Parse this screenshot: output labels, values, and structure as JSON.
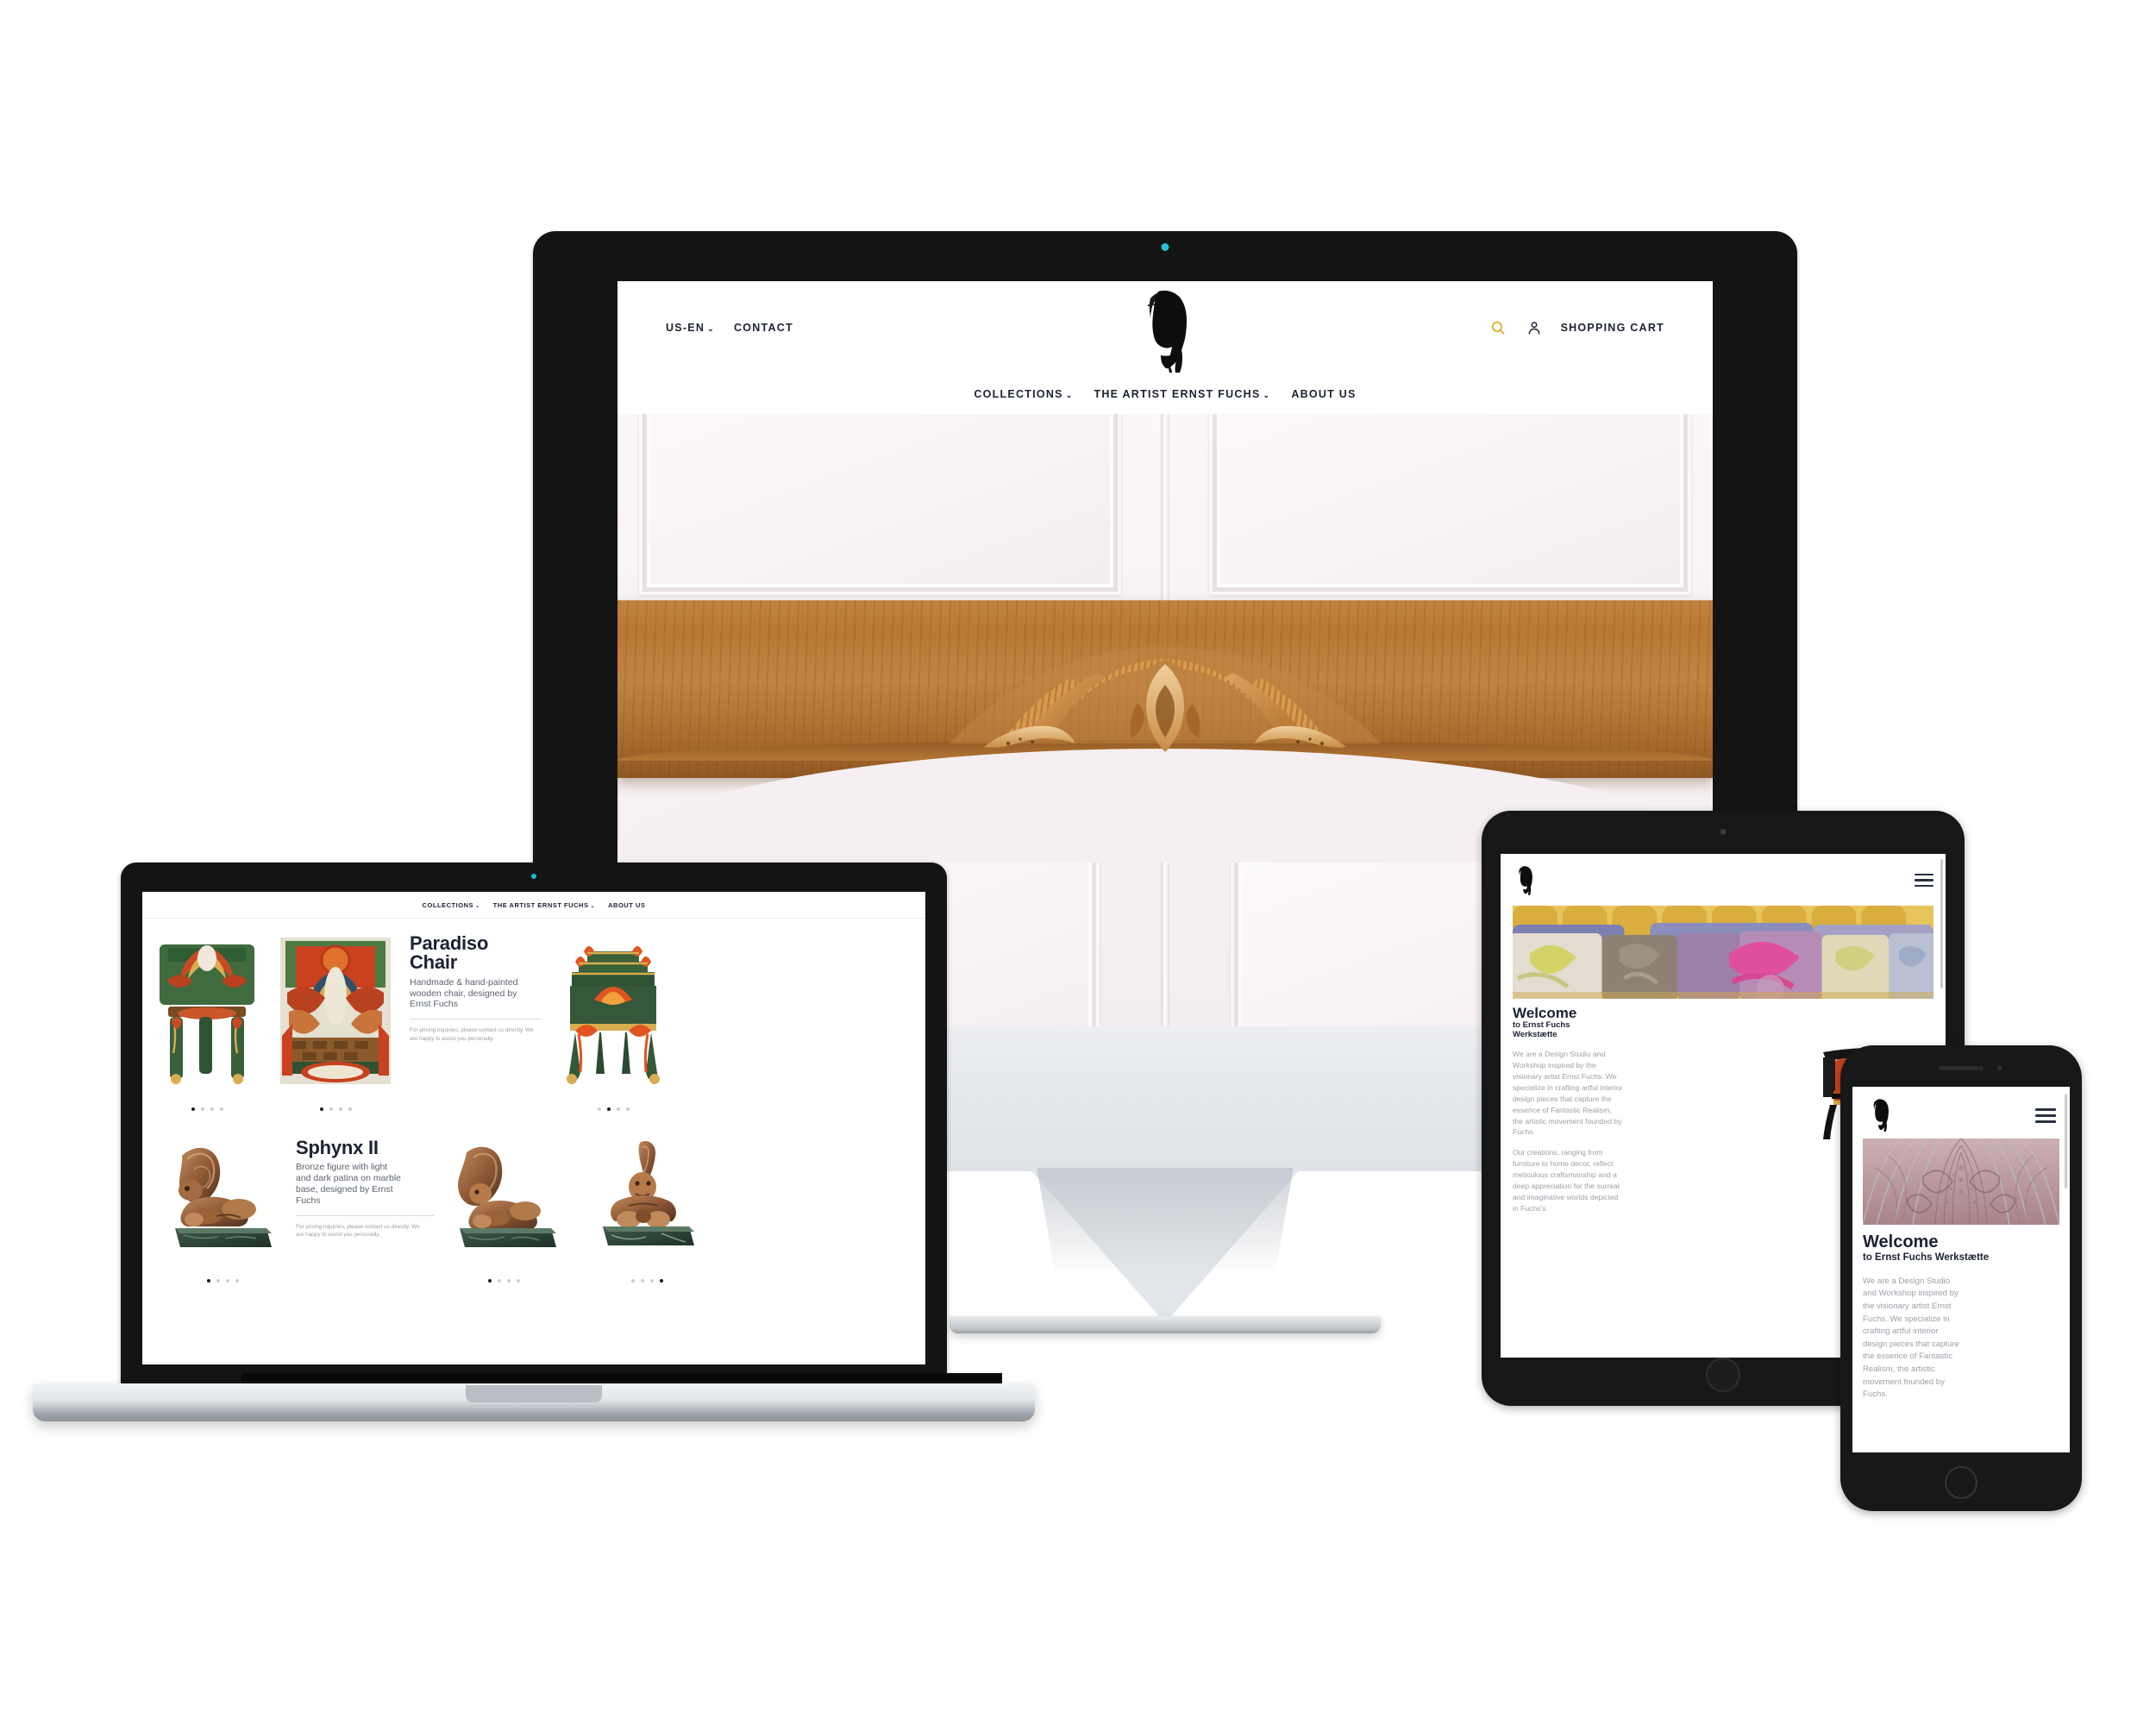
{
  "brand": {
    "name": "Ernst Fuchs Werkstaette",
    "logo_icon": "ernst-fuchs-portrait-logo"
  },
  "colors": {
    "accent_gold": "#D9A313",
    "ink": "#1B2232",
    "muted": "#9BA1A9",
    "rule": "#D9D9D9"
  },
  "desktop": {
    "utility_nav": {
      "locale": "US-EN",
      "locale_caret": "⌄",
      "contact": "CONTACT"
    },
    "actions": {
      "search_icon": "search-icon",
      "account_icon": "account-icon",
      "cart_label": "SHOPPING CART"
    },
    "main_nav": [
      {
        "label": "COLLECTIONS",
        "caret": "⌄"
      },
      {
        "label": "THE ARTIST ERNST FUCHS",
        "caret": "⌄"
      },
      {
        "label": "ABOUT US",
        "caret": ""
      }
    ],
    "hero_alt": "Carved wooden headboard with marquetry inlay"
  },
  "laptop": {
    "main_nav": [
      {
        "label": "COLLECTIONS",
        "caret": "⌄"
      },
      {
        "label": "THE ARTIST ERNST FUCHS",
        "caret": "⌄"
      },
      {
        "label": "ABOUT US",
        "caret": ""
      }
    ],
    "products": [
      {
        "title_line1": "Paradiso",
        "title_line2": "Chair",
        "description": "Handmade & hand-painted wooden chair, designed by Ernst Fuchs",
        "note": "For pricing inquiries, please contact us directly. We are happy to assist you personally.",
        "carousels": [
          {
            "dots": 4,
            "active": 0
          },
          {
            "dots": 4,
            "active": 0
          },
          {
            "dots": 4,
            "active": 1
          }
        ]
      },
      {
        "title_line1": "Sphynx II",
        "title_line2": "",
        "description": "Bronze figure with light and dark patina on marble base, designed by Ernst Fuchs",
        "note": "For pricing inquiries, please contact us directly. We are happy to assist you personally.",
        "carousels": [
          {
            "dots": 4,
            "active": 0
          },
          {
            "dots": 4,
            "active": 0
          },
          {
            "dots": 4,
            "active": 3
          }
        ]
      }
    ]
  },
  "tablet": {
    "menu_icon": "hamburger-menu-icon",
    "hero_alt": "Row of patterned throw pillows on a yellow sofa",
    "welcome_title": "Welcome",
    "welcome_sub_line1": "to Ernst Fuchs",
    "welcome_sub_line2": "Werkstætte",
    "paragraph1": "We are a Design Studio and Workshop inspired by the visionary artist Ernst Fuchs. We specialize in crafting artful interior design pieces that capture the essence of Fantastic Realism, the artistic movement founded by Fuchs.",
    "paragraph2": "Our creations, ranging from furniture to home decor, reflect meticulous craftsmanship and a deep appreciation for the surreal and imaginative worlds depicted in Fuchs's",
    "chair_alt": "Black framed armchair with red velvet upholstery"
  },
  "phone": {
    "menu_icon": "hamburger-menu-icon",
    "hero_alt": "Symmetrical rose and grey ornamental textile pattern",
    "welcome_title": "Welcome",
    "welcome_sub": "to Ernst Fuchs Werkstætte",
    "paragraph1": "We are a Design Studio and Workshop inspired by the visionary artist Ernst Fuchs. We specialize in crafting artful interior design pieces that capture the essence of Fantastic Realism, the artistic movement founded by Fuchs."
  }
}
